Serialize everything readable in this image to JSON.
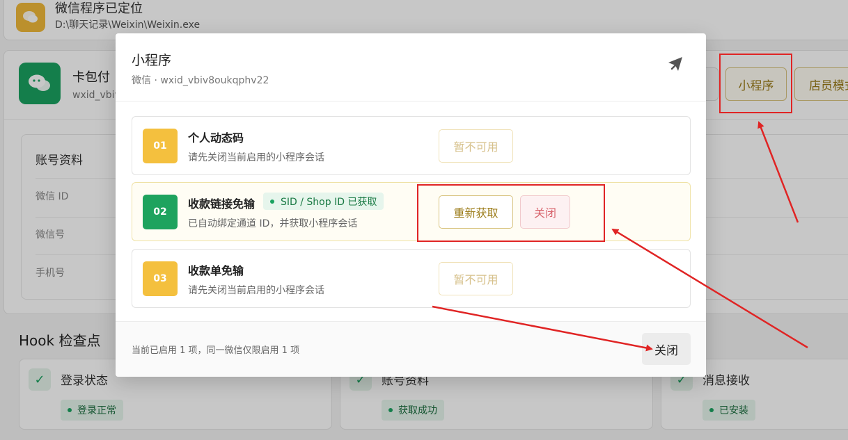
{
  "background": {
    "path_card": {
      "title": "微信程序已定位",
      "path": "D:\\聊天记录\\Weixin\\Weixin.exe"
    },
    "account": {
      "name": "卡包付",
      "id": "wxid_vbiv",
      "buttons": [
        "小程序",
        "店员模式"
      ]
    },
    "info": {
      "title": "账号资料",
      "labels": [
        "微信 ID",
        "微信号",
        "手机号"
      ]
    },
    "hooks": {
      "title": "Hook 检查点",
      "items": [
        {
          "name": "登录状态",
          "badge": "登录正常"
        },
        {
          "name": "账号资料",
          "badge": "获取成功"
        },
        {
          "name": "消息接收",
          "badge": "已安装"
        }
      ]
    }
  },
  "modal": {
    "title": "小程序",
    "subtitle": "微信 · wxid_vbiv8oukqphv22",
    "options": [
      {
        "num": "01",
        "title": "个人动态码",
        "desc": "请先关闭当前启用的小程序会话",
        "button": "暂不可用"
      },
      {
        "num": "02",
        "title": "收款链接免输",
        "tag": "SID / Shop ID 已获取",
        "desc": "已自动绑定通道 ID，并获取小程序会话",
        "button_refetch": "重新获取",
        "button_close": "关闭"
      },
      {
        "num": "03",
        "title": "收款单免输",
        "desc": "请先关闭当前启用的小程序会话",
        "button": "暂不可用"
      }
    ],
    "footer_text": "当前已启用 1 项，同一微信仅限启用 1 项",
    "footer_close": "关闭"
  },
  "colors": {
    "accent_gold": "#9a7a16",
    "success_green": "#1aa260",
    "warning_yellow": "#f4c03e",
    "danger_red": "#d8646d",
    "annotation_red": "#e02424"
  },
  "icons": [
    "chat-bubble-icon",
    "wechat-icon",
    "check-icon",
    "pin-icon"
  ]
}
